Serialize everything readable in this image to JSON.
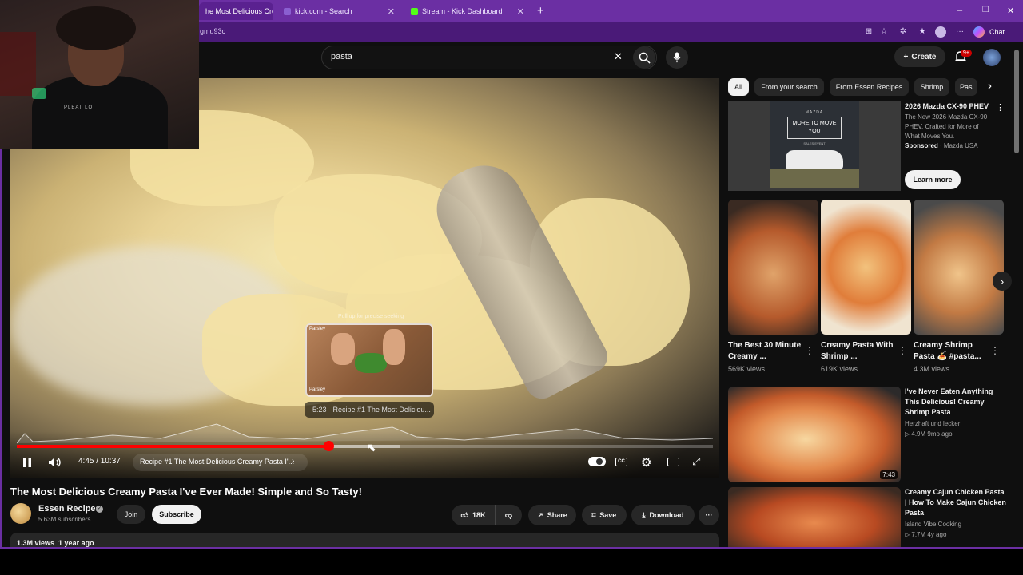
{
  "browser": {
    "tabs": [
      {
        "label": "he Most Delicious Cre",
        "close": "✕"
      },
      {
        "label": "kick.com - Search",
        "close": "✕"
      },
      {
        "label": "Stream - Kick Dashboard",
        "close": "✕"
      }
    ],
    "new_tab": "+",
    "url": "gmu93c",
    "chat_label": "Chat",
    "window_controls": [
      "–",
      "❐",
      "✕"
    ]
  },
  "header": {
    "search_value": "pasta",
    "create_label": "Create",
    "notif_badge": "9+"
  },
  "webcam": {
    "shirt_text": "PLEAT LO"
  },
  "player": {
    "preview_hint": "Pull up for precise seeking",
    "preview_time": "5:23 · Recipe #1 The Most Deliciou...",
    "preview_label_top": "Parsley",
    "preview_label_bottom": "Parsley",
    "time": "4:45 / 10:37",
    "chapter": "Recipe #1 The Most Delicious Creamy Pasta I'...",
    "progress_played_fraction": 0.448,
    "progress_loaded_fraction": 0.551
  },
  "video": {
    "title": "The Most Delicious Creamy Pasta I've Ever Made! Simple and So Tasty!",
    "channel": "Essen Recipes",
    "subscribers": "5.63M subscribers",
    "join_label": "Join",
    "subscribe_label": "Subscribe",
    "likes": "18K",
    "share_label": "Share",
    "save_label": "Save",
    "download_label": "Download",
    "views": "1.3M views",
    "age": "1 year ago"
  },
  "chips": [
    "All",
    "From your search",
    "From Essen Recipes",
    "Shrimp",
    "Pas"
  ],
  "ad": {
    "title": "2026 Mazda CX-90 PHEV",
    "desc": "The New 2026 Mazda CX-90 PHEV. Crafted for More of What Moves You.",
    "sponsored": "Sponsored",
    "advertiser": "Mazda USA",
    "learn_more": "Learn more",
    "brand": "MAZDA",
    "headline": "MORE TO MOVE YOU",
    "sub": "SALES EVENT"
  },
  "shorts": [
    {
      "title": "The Best 30 Minute Creamy ...",
      "views": "569K views"
    },
    {
      "title": "Creamy Pasta With Shrimp ...",
      "views": "619K views"
    },
    {
      "title": "Creamy Shrimp Pasta 🍝 #pasta...",
      "views": "4.3M views"
    }
  ],
  "recs": [
    {
      "title": "I've Never Eaten Anything This Delicious! Creamy Shrimp Pasta",
      "channel": "Herzhaft und lecker",
      "meta": "▷ 4.9M  9mo ago",
      "duration": "7:43"
    },
    {
      "title": "Creamy Cajun Chicken Pasta | How To Make Cajun Chicken Pasta",
      "channel": "Island Vibe Cooking",
      "meta": "▷ 7.7M  4y ago",
      "duration": ""
    }
  ],
  "colors": {
    "accent_red": "#ff0000",
    "browser_purple": "#6b2fa3"
  }
}
